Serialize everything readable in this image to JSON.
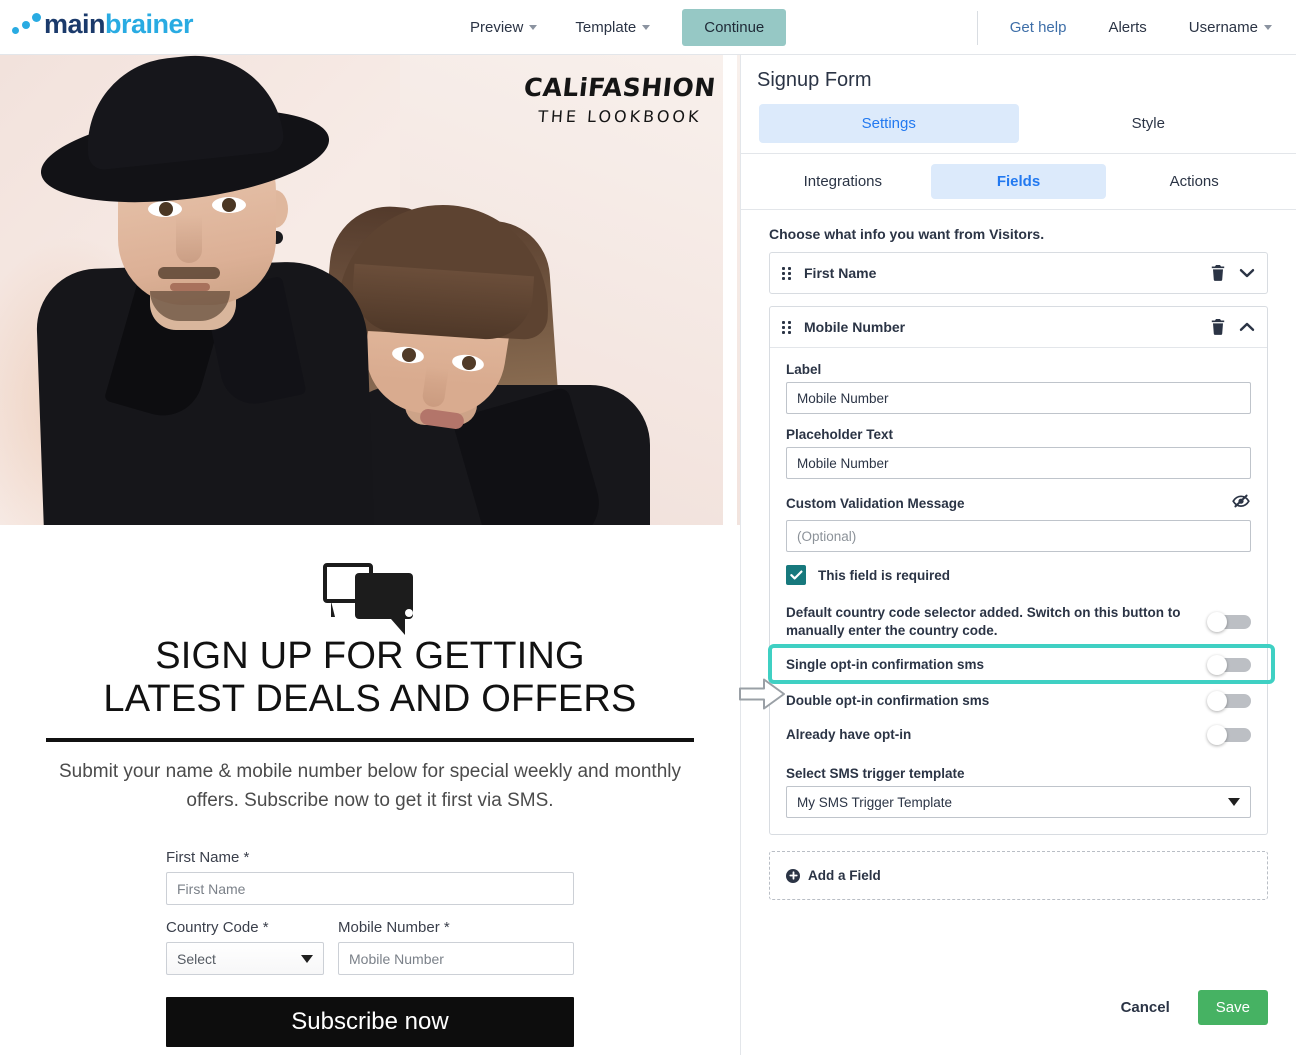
{
  "topnav": {
    "logo": {
      "main": "main",
      "brainer": "brainer"
    },
    "center_items": [
      {
        "label": "Preview",
        "has_caret": true
      },
      {
        "label": "Template",
        "has_caret": true
      }
    ],
    "continue_label": "Continue",
    "right_items": [
      {
        "label": "Get help",
        "has_caret": false
      },
      {
        "label": "Alerts",
        "has_caret": false
      },
      {
        "label": "Username",
        "has_caret": true
      }
    ]
  },
  "preview": {
    "hero": {
      "brand_line1": "CALiFASHION",
      "brand_line2": "THE LOOKBOOK"
    },
    "title_line1": "SIGN UP FOR GETTING",
    "title_line2": "LATEST DEALS AND OFFERS",
    "subtitle": "Submit your name & mobile number below for special weekly and monthly offers. Subscribe now to get it first via SMS.",
    "form": {
      "first_name_label": "First Name",
      "first_name_placeholder": "First Name",
      "country_code_label": "Country Code",
      "country_code_value": "Select",
      "mobile_label": "Mobile Number",
      "mobile_placeholder": "Mobile Number",
      "required_mark": "*",
      "submit_label": "Subscribe now"
    }
  },
  "panel": {
    "title": "Signup Form",
    "main_tabs": [
      {
        "label": "Settings",
        "active": true
      },
      {
        "label": "Style",
        "active": false
      }
    ],
    "sub_tabs": [
      {
        "label": "Integrations",
        "active": false
      },
      {
        "label": "Fields",
        "active": true
      },
      {
        "label": "Actions",
        "active": false
      }
    ],
    "hint": "Choose what info you want from Visitors.",
    "fields": [
      {
        "name": "First Name",
        "expanded": false
      },
      {
        "name": "Mobile Number",
        "expanded": true
      }
    ],
    "mobile_field": {
      "label_caption": "Label",
      "label_value": "Mobile Number",
      "placeholder_caption": "Placeholder Text",
      "placeholder_value": "Mobile Number",
      "validation_caption": "Custom Validation Message",
      "validation_placeholder": "(Optional)",
      "required_checkbox_label": "This field is required",
      "required_checked": true,
      "toggles": [
        {
          "label": "Default country code selector added. Switch on this button to manually enter the country code.",
          "on": false,
          "highlighted": false
        },
        {
          "label": "Single opt-in confirmation sms",
          "on": false,
          "highlighted": true
        },
        {
          "label": "Double opt-in confirmation sms",
          "on": false,
          "highlighted": false
        },
        {
          "label": "Already have opt-in",
          "on": false,
          "highlighted": false
        }
      ],
      "trigger_caption": "Select SMS trigger template",
      "trigger_value": "My SMS Trigger Template"
    },
    "add_field_label": "Add a Field",
    "cancel_label": "Cancel",
    "save_label": "Save"
  },
  "colors": {
    "accent_blue": "#2279f0",
    "tab_bg": "#dceafb",
    "highlight_teal": "#3fd0c3",
    "checkbox_teal": "#17797d",
    "save_green": "#46b263",
    "continue_teal": "#96c8c5"
  }
}
